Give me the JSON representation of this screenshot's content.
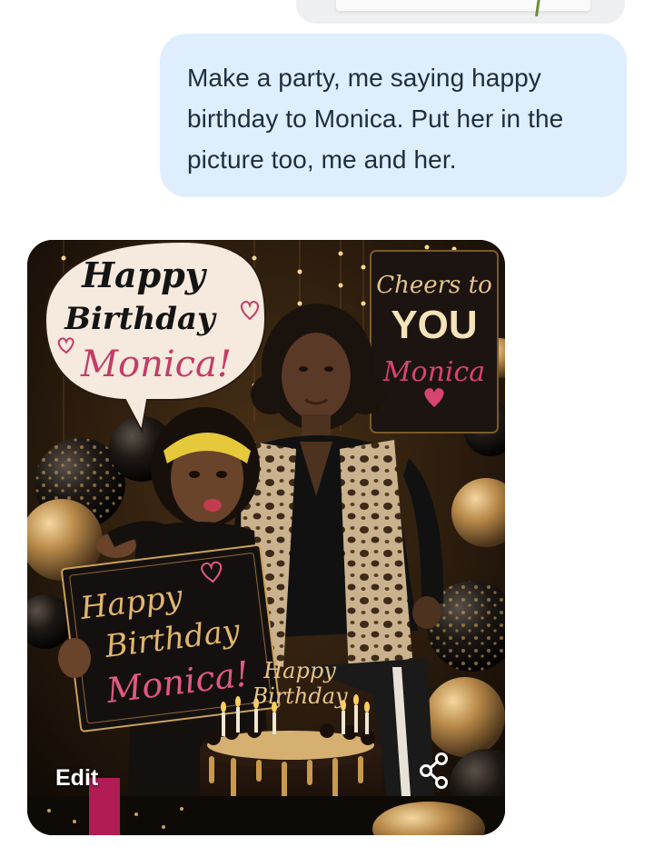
{
  "conversation": {
    "user_message": "Make a party, me saying happy birthday to Monica. Put her in the picture too, me and her."
  },
  "image_card": {
    "speech_bubble": {
      "line1": "Happy",
      "line2": "Birthday",
      "line3": "Monica!"
    },
    "banner": {
      "line1": "Cheers to",
      "line2": "YOU",
      "line3": "Monica"
    },
    "held_sign": {
      "line1": "Happy",
      "line2": "Birthday",
      "line3": "Monica!"
    },
    "cake_topper": {
      "line1": "Happy",
      "line2": "Birthday"
    },
    "edit_label": "Edit",
    "share_icon": "share-icon"
  },
  "colors": {
    "bubble_bg": "#dfeefd",
    "bubble_text": "#1f2d3d",
    "gold": "#d9a441",
    "pink": "#d6456f"
  }
}
